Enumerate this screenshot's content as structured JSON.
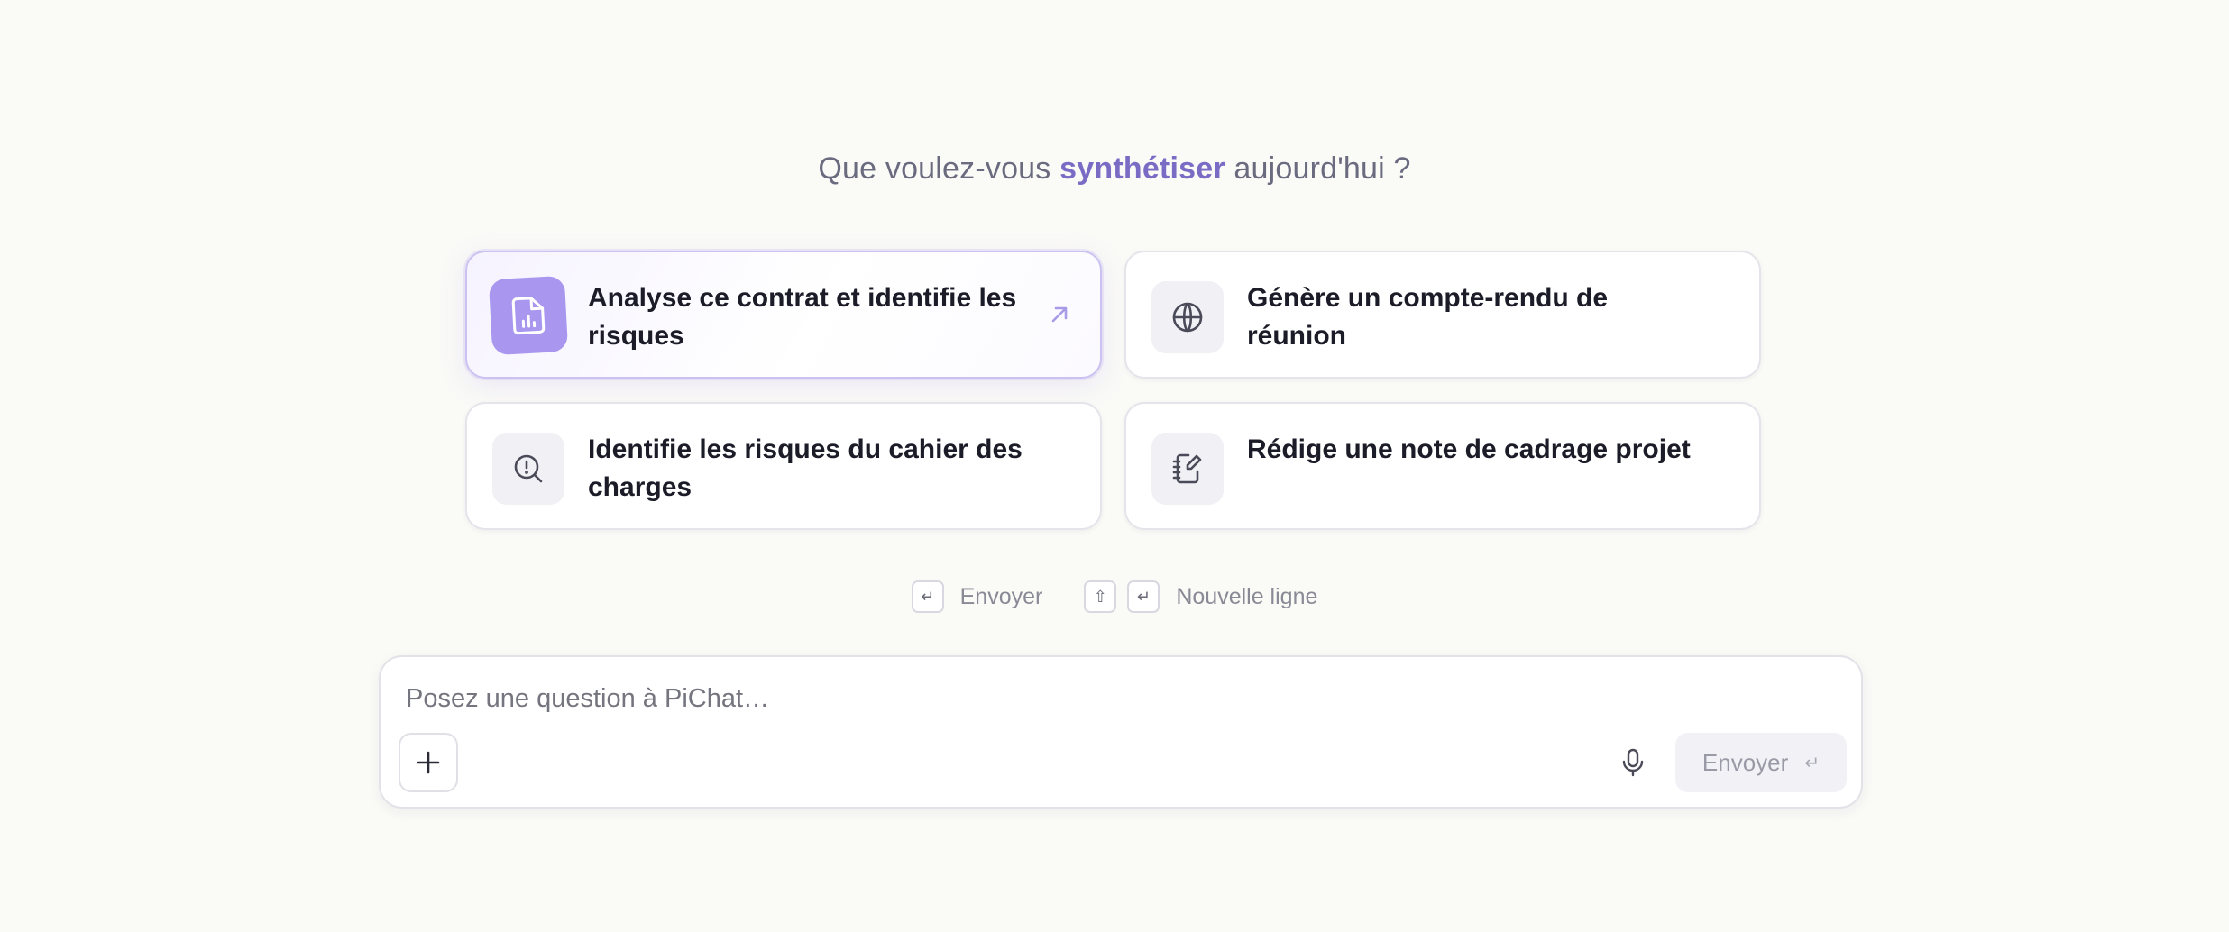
{
  "heading": {
    "prefix": "Que voulez-vous ",
    "accent": "synthétiser",
    "suffix": " aujourd'hui ?"
  },
  "suggestions": [
    {
      "label": "Analyse ce contrat et identifie les risques",
      "icon": "file-chart-icon",
      "active": true
    },
    {
      "label": "Génère un compte-rendu de réunion",
      "icon": "globe-icon",
      "active": false
    },
    {
      "label": "Identifie les risques du cahier des charges",
      "icon": "search-alert-icon",
      "active": false
    },
    {
      "label": "Rédige une note de cadrage projet",
      "icon": "notebook-pen-icon",
      "active": false
    }
  ],
  "hints": {
    "send_key": "↵",
    "send_label": "Envoyer",
    "shift_key": "⇧",
    "enter_key": "↵",
    "newline_label": "Nouvelle ligne"
  },
  "composer": {
    "placeholder": "Posez une question à PiChat…",
    "send_label": "Envoyer",
    "send_key": "↵"
  },
  "colors": {
    "accent": "#7a6cc4",
    "active_icon_bg": "#a997ef",
    "background": "#fafaf7"
  }
}
